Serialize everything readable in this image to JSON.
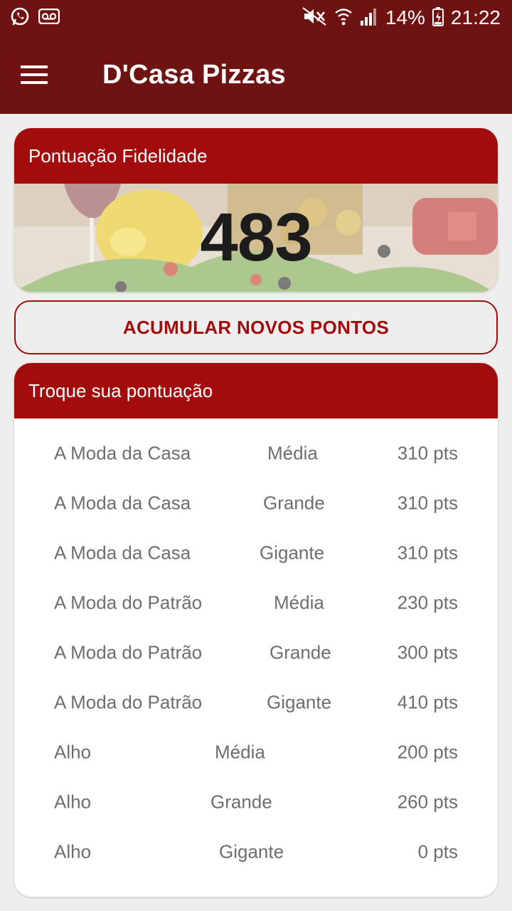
{
  "status": {
    "battery": "14%",
    "time": "21:22",
    "icons_left": [
      "whatsapp-icon",
      "voicemail-icon"
    ],
    "icons_right": [
      "mute-icon",
      "wifi-icon",
      "signal-icon",
      "battery-icon"
    ]
  },
  "app_bar": {
    "title": "D'Casa Pizzas",
    "menu_icon": "hamburger-menu-icon"
  },
  "colors": {
    "app_bar": "#6e1212",
    "header": "#a30c0c",
    "background": "#eeeeee",
    "text_muted": "#6e6e6e"
  },
  "score_card": {
    "title": "Pontuação Fidelidade",
    "points": "483"
  },
  "accumulate_button": {
    "label": "ACUMULAR NOVOS PONTOS"
  },
  "rewards_card": {
    "title": "Troque sua pontuação",
    "items": [
      {
        "name": "A Moda da Casa",
        "size": "Média",
        "points": "310 pts"
      },
      {
        "name": "A Moda da Casa",
        "size": "Grande",
        "points": "310 pts"
      },
      {
        "name": "A Moda da Casa",
        "size": "Gigante",
        "points": "310 pts"
      },
      {
        "name": "A Moda do Patrão",
        "size": "Média",
        "points": "230 pts"
      },
      {
        "name": "A Moda do Patrão",
        "size": "Grande",
        "points": "300 pts"
      },
      {
        "name": "A Moda do Patrão",
        "size": "Gigante",
        "points": "410 pts"
      },
      {
        "name": "Alho",
        "size": "Média",
        "points": "200 pts"
      },
      {
        "name": "Alho",
        "size": "Grande",
        "points": "260 pts"
      },
      {
        "name": "Alho",
        "size": "Gigante",
        "points": "0 pts"
      }
    ]
  }
}
